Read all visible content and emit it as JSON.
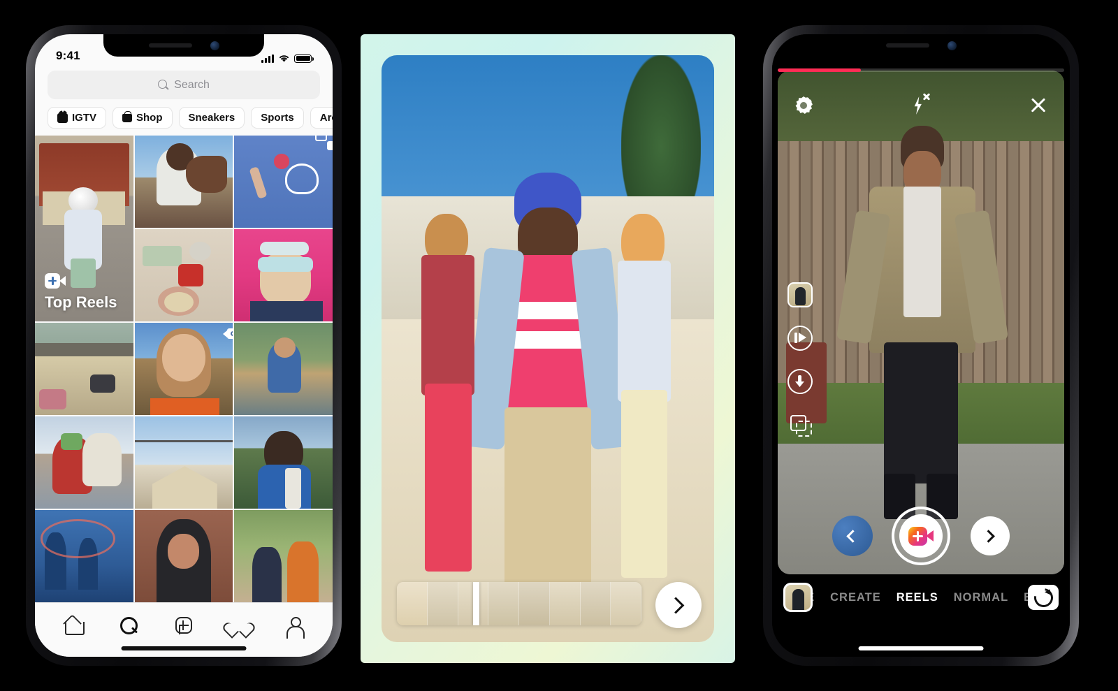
{
  "phone1": {
    "status_bar": {
      "time": "9:41",
      "signal_icon": "cellular-bars-icon",
      "wifi_icon": "wifi-icon",
      "battery_icon": "battery-full-icon"
    },
    "search": {
      "placeholder": "Search",
      "icon": "search-icon"
    },
    "chips": [
      {
        "label": "IGTV",
        "icon": "igtv-icon"
      },
      {
        "label": "Shop",
        "icon": "shop-bag-icon"
      },
      {
        "label": "Sneakers",
        "icon": ""
      },
      {
        "label": "Sports",
        "icon": ""
      },
      {
        "label": "Architecture",
        "icon": ""
      }
    ],
    "grid": [
      {
        "name": "top-reels-tile",
        "badge": "",
        "label": "Top Reels",
        "label_icon": "reels-icon",
        "tall": true,
        "colors": [
          "#8fa8b8",
          "#c8b49a",
          "#6f6a60"
        ]
      },
      {
        "name": "grid-tile-2",
        "badge": "",
        "colors": [
          "#6fa8dc",
          "#c9c2b4",
          "#6a5244"
        ]
      },
      {
        "name": "grid-tile-3",
        "badge": "carousel-icon",
        "colors": [
          "#5a7fc4",
          "#5a7fc4",
          "#4f74ba"
        ]
      },
      {
        "name": "grid-tile-4",
        "badge": "",
        "colors": [
          "#d8cfc2",
          "#c76a52",
          "#a8a094"
        ]
      },
      {
        "name": "grid-tile-5",
        "badge": "",
        "colors": [
          "#e23a82",
          "#e8558f",
          "#d22a74"
        ]
      },
      {
        "name": "grid-tile-6",
        "badge": "",
        "colors": [
          "#9aa6a2",
          "#cfc2a4",
          "#8e8778"
        ]
      },
      {
        "name": "grid-tile-7",
        "badge": "video-icon",
        "colors": [
          "#4f86c6",
          "#c99a62",
          "#e0622e"
        ]
      },
      {
        "name": "grid-tile-8",
        "badge": "",
        "colors": [
          "#9fb4a0",
          "#b99a6e",
          "#5f7a7e"
        ]
      },
      {
        "name": "grid-tile-9",
        "badge": "",
        "colors": [
          "#b8c9dc",
          "#c7352e",
          "#8e9aa6"
        ]
      },
      {
        "name": "grid-tile-10",
        "badge": "",
        "colors": [
          "#a7c3dd",
          "#d9cfb8",
          "#9a917f"
        ]
      },
      {
        "name": "grid-tile-11",
        "badge": "",
        "colors": [
          "#88a8c8",
          "#4d7a4a",
          "#2d5ea0"
        ]
      },
      {
        "name": "grid-tile-12",
        "badge": "",
        "colors": [
          "#2e5b96",
          "#3f74b4",
          "#1e4274"
        ]
      },
      {
        "name": "grid-tile-13",
        "badge": "",
        "colors": [
          "#8e5a46",
          "#3b3b3b",
          "#6a4034"
        ]
      },
      {
        "name": "grid-tile-14",
        "badge": "",
        "colors": [
          "#7c9a62",
          "#cfb894",
          "#5a7448"
        ]
      }
    ],
    "tabbar": [
      {
        "name": "tab-home",
        "icon": "home-icon",
        "active": false
      },
      {
        "name": "tab-search",
        "icon": "search-icon",
        "active": true
      },
      {
        "name": "tab-create",
        "icon": "plus-square-icon",
        "active": false
      },
      {
        "name": "tab-activity",
        "icon": "heart-icon",
        "active": false
      },
      {
        "name": "tab-profile",
        "icon": "person-icon",
        "active": false
      }
    ]
  },
  "phone2": {
    "scrubber": {
      "name": "video-timeline",
      "frames": 8,
      "playhead_percent": 31
    },
    "next_button": {
      "name": "next-button",
      "icon": "chevron-right-icon"
    },
    "border_gradient": [
      "#d3f5ea",
      "#cdf3ee",
      "#e6f6dd",
      "#eef7d4"
    ]
  },
  "phone3": {
    "recording_progress_percent": 29,
    "progress_color": "#ff2d55",
    "top_bar": [
      {
        "name": "camera-settings-button",
        "icon": "gear-icon"
      },
      {
        "name": "flash-toggle-button",
        "icon": "flash-off-icon"
      },
      {
        "name": "close-camera-button",
        "icon": "close-icon"
      }
    ],
    "side_tools": [
      {
        "name": "audio-tool",
        "icon": "audio-thumbnail-icon"
      },
      {
        "name": "speed-tool",
        "icon": "playback-speed-icon"
      },
      {
        "name": "timer-tool",
        "icon": "timer-icon"
      },
      {
        "name": "align-tool",
        "icon": "align-layout-icon"
      }
    ],
    "capture": {
      "gallery": {
        "name": "gallery-thumbnail-button",
        "icon": "chevron-left-icon"
      },
      "shutter": {
        "name": "shutter-button",
        "icon": "reels-gradient-icon"
      },
      "next": {
        "name": "next-button",
        "icon": "chevron-right-icon"
      }
    },
    "mode_bar": {
      "thumbnail": {
        "name": "effects-thumbnail-button",
        "icon": "effect-thumbnail-icon"
      },
      "modes": [
        {
          "label": "VE",
          "active": false
        },
        {
          "label": "CREATE",
          "active": false
        },
        {
          "label": "REELS",
          "active": true
        },
        {
          "label": "NORMAL",
          "active": false
        },
        {
          "label": "BO",
          "active": false
        }
      ],
      "flip": {
        "name": "flip-camera-button",
        "icon": "flip-camera-icon"
      }
    }
  }
}
